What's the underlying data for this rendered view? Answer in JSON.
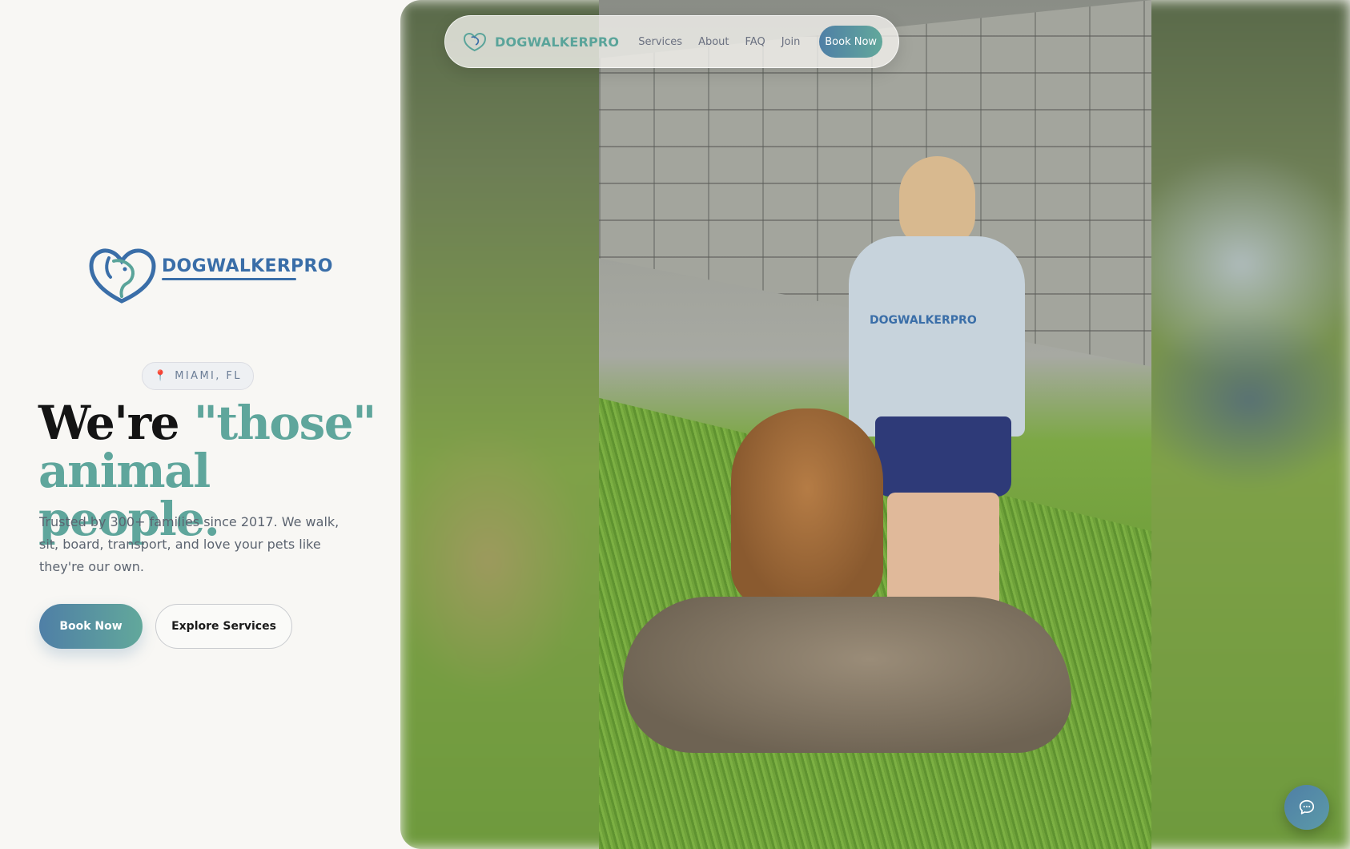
{
  "brand": {
    "name": "DOGWALKERPRO"
  },
  "nav": {
    "logo_text": "DOGWALKERPRO",
    "links": [
      "Services",
      "About",
      "FAQ",
      "Join"
    ],
    "cta": "Book Now"
  },
  "hero": {
    "location": "MIAMI, FL",
    "headline_part1": "We're ",
    "headline_accent": "\"those\" animal people.",
    "lead": "Trusted by 300+ families since 2017. We walk, sit, board, transport, and love your pets like they're our own.",
    "primary_cta": "Book Now",
    "secondary_cta": "Explore Services"
  },
  "photo": {
    "shirt_text": "DOGWALKERPRO"
  },
  "icons": {
    "brand": "dog-heart-logo-icon",
    "location": "map-pin-icon",
    "chat": "chat-bubble-icon"
  },
  "colors": {
    "accent_teal": "#5fa69c",
    "brand_blue": "#3a6ea8",
    "gradient_start": "#4f7fa6",
    "gradient_end": "#62a89b",
    "background": "#f8f7f4"
  }
}
